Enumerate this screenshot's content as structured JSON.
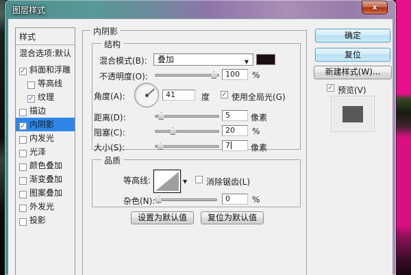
{
  "window": {
    "title": "图层样式",
    "close_glyph": "x"
  },
  "misc": {
    "check_glyph": "✓",
    "dropdown_arrow": "▼",
    "contour_arrow": "▼"
  },
  "sidebar": {
    "header": "样式",
    "items": [
      {
        "id": "blending-options",
        "label": "混合选项:默认",
        "has_checkbox": false,
        "checked": false,
        "indent": false,
        "selected": false
      },
      {
        "id": "bevel-and-emboss",
        "label": "斜面和浮雕",
        "has_checkbox": true,
        "checked": true,
        "indent": false,
        "selected": false
      },
      {
        "id": "contour",
        "label": "等高线",
        "has_checkbox": true,
        "checked": false,
        "indent": true,
        "selected": false
      },
      {
        "id": "texture",
        "label": "纹理",
        "has_checkbox": true,
        "checked": true,
        "indent": true,
        "selected": false
      },
      {
        "id": "stroke",
        "label": "描边",
        "has_checkbox": true,
        "checked": false,
        "indent": false,
        "selected": false
      },
      {
        "id": "inner-shadow",
        "label": "内阴影",
        "has_checkbox": true,
        "checked": true,
        "indent": false,
        "selected": true
      },
      {
        "id": "inner-glow",
        "label": "内发光",
        "has_checkbox": true,
        "checked": false,
        "indent": false,
        "selected": false
      },
      {
        "id": "satin",
        "label": "光泽",
        "has_checkbox": true,
        "checked": false,
        "indent": false,
        "selected": false
      },
      {
        "id": "color-overlay",
        "label": "颜色叠加",
        "has_checkbox": true,
        "checked": false,
        "indent": false,
        "selected": false
      },
      {
        "id": "gradient-overlay",
        "label": "渐变叠加",
        "has_checkbox": true,
        "checked": false,
        "indent": false,
        "selected": false
      },
      {
        "id": "pattern-overlay",
        "label": "图案叠加",
        "has_checkbox": true,
        "checked": false,
        "indent": false,
        "selected": false
      },
      {
        "id": "outer-glow",
        "label": "外发光",
        "has_checkbox": true,
        "checked": false,
        "indent": false,
        "selected": false
      },
      {
        "id": "drop-shadow",
        "label": "投影",
        "has_checkbox": true,
        "checked": false,
        "indent": false,
        "selected": false
      }
    ]
  },
  "panel": {
    "title": "内阴影",
    "structure": {
      "legend": "结构",
      "blend_mode": {
        "label": "混合模式(B):",
        "value": "叠加",
        "swatch_color": "#1c0d10"
      },
      "opacity": {
        "label": "不透明度(O):",
        "value": "100",
        "unit": "%"
      },
      "angle": {
        "label": "角度(A):",
        "value": "41",
        "unit": "度",
        "degrees": 41,
        "global_light_label": "使用全局光(G)",
        "global_light_checked": true
      },
      "distance": {
        "label": "距离(D):",
        "value": "5",
        "unit": "像素"
      },
      "choke": {
        "label": "阻塞(C):",
        "value": "20",
        "unit": "%"
      },
      "size": {
        "label": "大小(S):",
        "value": "7",
        "unit": "像素"
      }
    },
    "quality": {
      "legend": "品质",
      "contour": {
        "label": "等高线:",
        "anti_alias_label": "消除锯齿(L)",
        "anti_alias_checked": false
      },
      "noise": {
        "label": "杂色(N):",
        "value": "0",
        "unit": "%"
      }
    },
    "footer": {
      "make_default": "设置为默认值",
      "reset_default": "复位为默认值"
    }
  },
  "actions": {
    "ok": "确定",
    "reset": "复位",
    "new_style": "新建样式(W)...",
    "preview_label": "预览(V)",
    "preview_checked": true
  },
  "colors": {
    "selection_blue": "#2e87e8",
    "titlebar_teal": "#579996",
    "titlebar_purple": "#9579ad",
    "desktop_pink": "#e70f8c",
    "blend_swatch": "#1c0d10",
    "preview_inner_gray": "#585858"
  }
}
